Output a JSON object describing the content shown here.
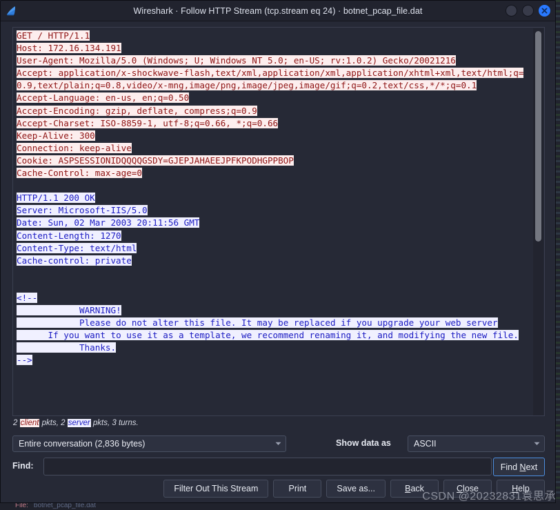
{
  "window": {
    "title": "Wireshark · Follow HTTP Stream (tcp.stream eq 24) · botnet_pcap_file.dat",
    "logo_icon": "wireshark-shark-fin-icon",
    "controls": {
      "minimize_icon": "minimize-icon",
      "maximize_icon": "maximize-icon",
      "close_icon": "close-icon"
    },
    "accent_color": "#2979ff"
  },
  "stream": {
    "client_color": "#8e1414",
    "client_bg": "#fdeeee",
    "server_color": "#1a1ac2",
    "server_bg": "#f0f0ff",
    "scrollbar_name": "stream-vertical-scrollbar",
    "blocks": [
      {
        "direction": "client",
        "text": "GET / HTTP/1.1\nHost: 172.16.134.191\nUser-Agent: Mozilla/5.0 (Windows; U; Windows NT 5.0; en-US; rv:1.0.2) Gecko/20021216\nAccept: application/x-shockwave-flash,text/xml,application/xml,application/xhtml+xml,text/html;q=0.9,text/plain;q=0.8,video/x-mng,image/png,image/jpeg,image/gif;q=0.2,text/css,*/*;q=0.1\nAccept-Language: en-us, en;q=0.50\nAccept-Encoding: gzip, deflate, compress;q=0.9\nAccept-Charset: ISO-8859-1, utf-8;q=0.66, *;q=0.66\nKeep-Alive: 300\nConnection: keep-alive\nCookie: ASPSESSIONIDQQQQGSDY=GJEPJAHAEEJPFKPODHGPPBOP\nCache-Control: max-age=0"
      },
      {
        "direction": "blank",
        "text": ""
      },
      {
        "direction": "server",
        "text": "HTTP/1.1 200 OK\nServer: Microsoft-IIS/5.0\nDate: Sun, 02 Mar 2003 20:11:56 GMT\nContent-Length: 1270\nContent-Type: text/html\nCache-control: private"
      },
      {
        "direction": "blank",
        "text": ""
      },
      {
        "direction": "blank",
        "text": ""
      },
      {
        "direction": "server",
        "text": "<!--\n            WARNING!\n            Please do not alter this file. It may be replaced if you upgrade your web server\n      If you want to use it as a template, we recommend renaming it, and modifying the new file.\n            Thanks.\n-->"
      }
    ]
  },
  "packet_counts": {
    "prefix": "2 ",
    "client_word": "client",
    "mid": " pkts, 2 ",
    "server_word": "server",
    "suffix": " pkts, 3 turns."
  },
  "controls": {
    "conversation_value": "Entire conversation (2,836 bytes)",
    "show_data_as_label": "Show data as",
    "show_data_as_value": "ASCII",
    "dropdown_icon": "chevron-down-icon"
  },
  "find": {
    "label": "Find:",
    "value": "",
    "placeholder": "",
    "button_prefix": "Find ",
    "button_mnemonic": "N",
    "button_suffix": "ext"
  },
  "buttons": {
    "filter_out": "Filter Out This Stream",
    "print": "Print",
    "save_as": "Save as...",
    "back_prefix": "",
    "back_mnemonic": "B",
    "back_suffix": "ack",
    "close_prefix": "",
    "close_mnemonic": "C",
    "close_suffix": "lose",
    "help_prefix": "",
    "help_mnemonic": "H",
    "help_suffix": "elp"
  },
  "watermark": {
    "text": "CSDN @20232831袁思承"
  },
  "background": {
    "status_tag": "File:",
    "status_text": "botnet_pcap_file.dat"
  }
}
